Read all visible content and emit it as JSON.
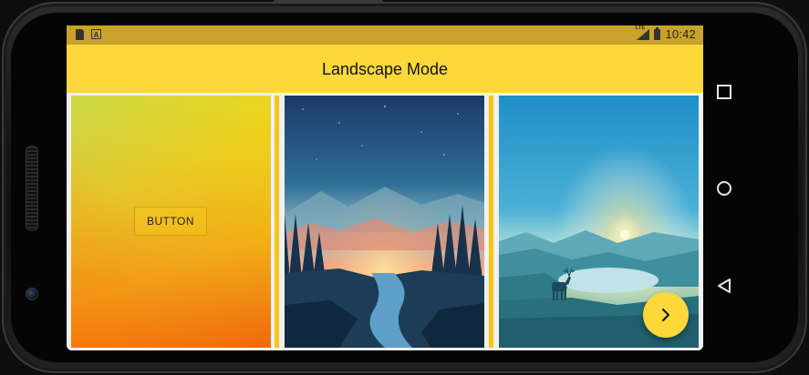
{
  "status_bar": {
    "time": "10:42",
    "left_icons": [
      "sd-card-icon",
      "a-notification-icon"
    ],
    "right_icons": [
      "lte-signal-icon",
      "battery-icon"
    ],
    "lte_label": "LTE"
  },
  "app_bar": {
    "title": "Landscape Mode",
    "color": "#fdd83a"
  },
  "panels": [
    {
      "name": "gradient-panel",
      "button_label": "BUTTON"
    },
    {
      "name": "forest-river-image"
    },
    {
      "name": "deer-lake-image"
    }
  ],
  "fab": {
    "icon": "chevron-right-icon"
  },
  "nav_bar": {
    "items": [
      "recents-square-icon",
      "home-circle-icon",
      "back-triangle-icon"
    ]
  },
  "colors": {
    "accent": "#fdd83a",
    "status_bar": "#c8a22a",
    "divider": "#f5c518"
  }
}
